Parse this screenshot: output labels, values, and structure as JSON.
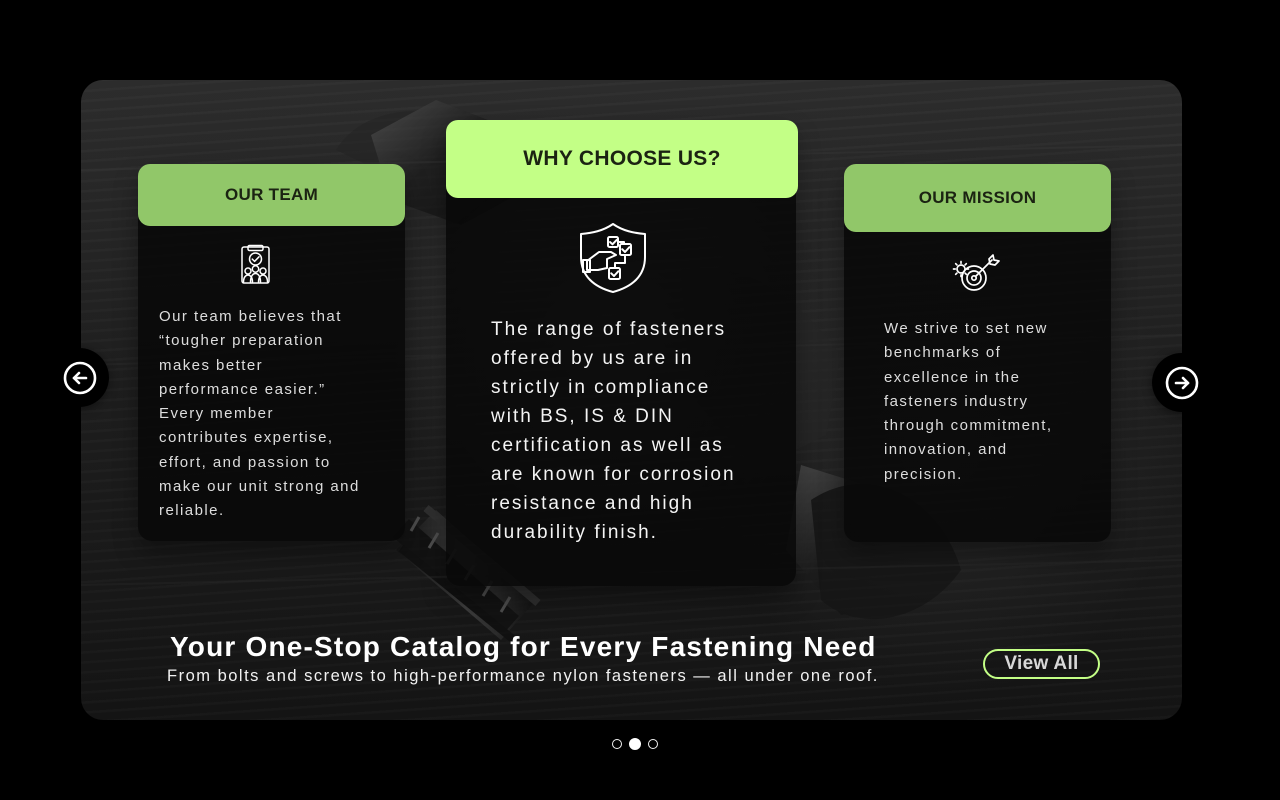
{
  "carousel": {
    "cards": [
      {
        "title": "OUR TEAM",
        "icon": "team-clipboard-icon",
        "text": "Our team believes that\n“tougher preparation\nmakes better\nperformance easier.”\nEvery member\ncontributes expertise,\neffort, and passion to\nmake our unit strong and\nreliable."
      },
      {
        "title": "WHY CHOOSE US?",
        "icon": "shield-checklist-icon",
        "text": "The range of fasteners\noffered by us are in\nstrictly in compliance\nwith BS, IS & DIN\ncertification as well as\nare known for corrosion\nresistance and high\ndurability finish."
      },
      {
        "title": "OUR MISSION",
        "icon": "target-gear-icon",
        "text": "We strive to set new\nbenchmarks of\nexcellence in the\nfasteners industry\nthrough commitment,\ninnovation, and\nprecision."
      }
    ],
    "nav": {
      "prev_icon": "arrow-left-circle-icon",
      "next_icon": "arrow-right-circle-icon"
    },
    "pagination": {
      "total": 3,
      "active_index": 1
    }
  },
  "hero": {
    "title": "Your One-Stop Catalog for Every Fastening Need",
    "subtitle": "From bolts and screws to high-performance nylon fasteners — all under one roof.",
    "view_all_label": "View All"
  },
  "colors": {
    "accent_green": "#c3ff86",
    "side_header_green": "#91c769",
    "card_background": "#080808",
    "page_background": "#000000"
  }
}
